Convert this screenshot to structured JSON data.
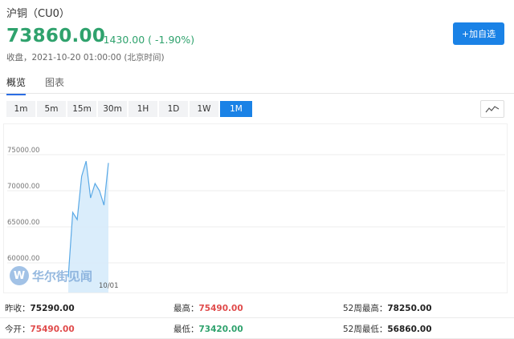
{
  "header": {
    "title": "沪铜（CU0）",
    "price": "73860.00",
    "change": "-1430.00 ( -1.90%)",
    "status": "收盘，2021-10-20 01:00:00 (北京时间)",
    "add_button": "+加自选"
  },
  "tabs": [
    {
      "label": "概览",
      "active": true
    },
    {
      "label": "图表",
      "active": false
    }
  ],
  "periods": [
    {
      "label": "1m"
    },
    {
      "label": "5m"
    },
    {
      "label": "15m"
    },
    {
      "label": "30m"
    },
    {
      "label": "1H"
    },
    {
      "label": "1D"
    },
    {
      "label": "1W"
    },
    {
      "label": "1M",
      "active": true
    }
  ],
  "chart_data": {
    "type": "area",
    "y_ticks": [
      "75000.00",
      "70000.00",
      "65000.00",
      "60000.00"
    ],
    "ylim": [
      60000,
      75000
    ],
    "x_tick_label": "10/01",
    "series": [
      {
        "values": [
          58000,
          67000,
          66000,
          72000,
          74100,
          69000,
          71000,
          70000,
          68000,
          73860
        ]
      }
    ],
    "line_color": "#5aa9e6",
    "fill_color": "#d6ebfb"
  },
  "watermark": {
    "text": "华尔街见闻",
    "logo": "W"
  },
  "stats": {
    "row1": [
      {
        "label": "昨收：",
        "value": "75290.00",
        "tone": "dark"
      },
      {
        "label": "最高：",
        "value": "75490.00",
        "tone": "red"
      },
      {
        "label": "52周最高：",
        "value": "78250.00",
        "tone": "dark"
      }
    ],
    "row2": [
      {
        "label": "今开：",
        "value": "75490.00",
        "tone": "red"
      },
      {
        "label": "最低：",
        "value": "73420.00",
        "tone": "green"
      },
      {
        "label": "52周最低：",
        "value": "56860.00",
        "tone": "dark"
      }
    ]
  }
}
